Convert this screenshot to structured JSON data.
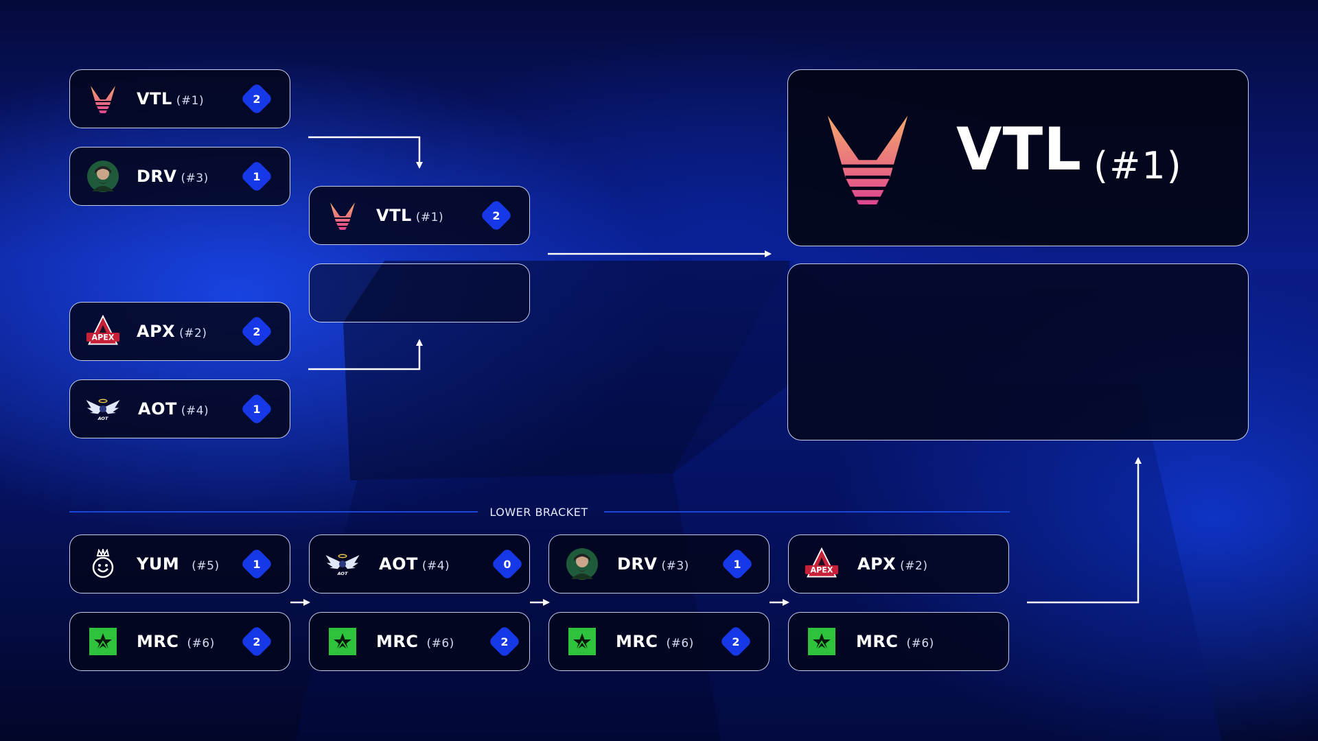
{
  "upper_bracket": {
    "semifinal_1": [
      {
        "abbr": "VTL",
        "seed": "(#1)",
        "score": "2",
        "logo": "vtl-logo-icon"
      },
      {
        "abbr": "DRV",
        "seed": "(#3)",
        "score": "1",
        "logo": "drv-logo-icon"
      }
    ],
    "semifinal_2": [
      {
        "abbr": "APX",
        "seed": "(#2)",
        "score": "2",
        "logo": "apx-logo-icon"
      },
      {
        "abbr": "AOT",
        "seed": "(#4)",
        "score": "1",
        "logo": "aot-logo-icon"
      }
    ],
    "final": [
      {
        "abbr": "VTL",
        "seed": "(#1)",
        "score": "2",
        "logo": "vtl-logo-icon"
      }
    ]
  },
  "grand_final": {
    "slot_1": {
      "abbr": "VTL",
      "seed": "(#1)",
      "logo": "vtl-logo-icon"
    }
  },
  "lower_bracket": {
    "label": "LOWER BRACKET",
    "round_1": [
      {
        "abbr": "YUM",
        "seed": "(#5)",
        "score": "1",
        "logo": "yum-logo-icon"
      },
      {
        "abbr": "MRC",
        "seed": "(#6)",
        "score": "2",
        "logo": "mrc-logo-icon"
      }
    ],
    "round_2": [
      {
        "abbr": "AOT",
        "seed": "(#4)",
        "score": "0",
        "logo": "aot-logo-icon"
      },
      {
        "abbr": "MRC",
        "seed": "(#6)",
        "score": "2",
        "logo": "mrc-logo-icon"
      }
    ],
    "round_3": [
      {
        "abbr": "DRV",
        "seed": "(#3)",
        "score": "1",
        "logo": "drv-logo-icon"
      },
      {
        "abbr": "MRC",
        "seed": "(#6)",
        "score": "2",
        "logo": "mrc-logo-icon"
      }
    ],
    "final": [
      {
        "abbr": "APX",
        "seed": "(#2)",
        "logo": "apx-logo-icon"
      },
      {
        "abbr": "MRC",
        "seed": "(#6)",
        "logo": "mrc-logo-icon"
      }
    ]
  },
  "colors": {
    "score_badge": "#1638e6",
    "divider": "#1b47d8",
    "card_border": "#dce4ff",
    "mrc_green": "#2fc23c"
  }
}
